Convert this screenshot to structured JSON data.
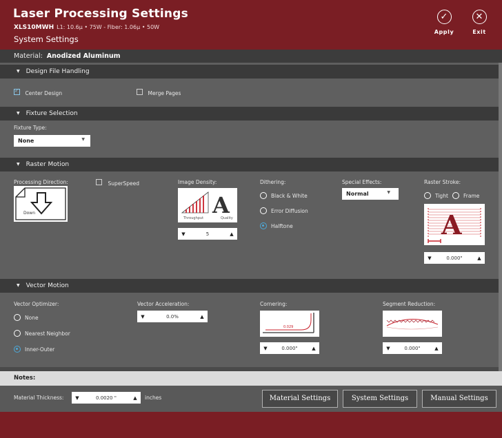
{
  "header": {
    "title": "Laser Processing Settings",
    "machine_model": "XLS10MWH",
    "machine_details": "L1: 10.6µ • 75W - Fiber: 1.06µ • 50W",
    "subtitle": "System Settings",
    "apply_label": "Apply",
    "exit_label": "Exit"
  },
  "material": {
    "label": "Material:",
    "value": "Anodized Aluminum"
  },
  "design_file": {
    "title": "Design File Handling",
    "center_design": {
      "label": "Center Design",
      "checked": true
    },
    "merge_pages": {
      "label": "Merge Pages",
      "checked": false
    }
  },
  "fixture": {
    "title": "Fixture Selection",
    "type_label": "Fixture Type:",
    "type_value": "None"
  },
  "raster": {
    "title": "Raster Motion",
    "direction_label": "Processing Direction:",
    "direction_value": "Down",
    "superspeed_label": "SuperSpeed",
    "density_label": "Image Density:",
    "density_left": "Throughput",
    "density_right": "Quality",
    "density_value": "5",
    "dithering_label": "Dithering:",
    "dithering_options": [
      "Black & White",
      "Error Diffusion",
      "Halftone"
    ],
    "dithering_selected": "Halftone",
    "effects_label": "Special Effects:",
    "effects_value": "Normal",
    "stroke_label": "Raster Stroke:",
    "stroke_tight": "Tight",
    "stroke_frame": "Frame",
    "stroke_value": "0.000\""
  },
  "vector": {
    "title": "Vector Motion",
    "optimizer_label": "Vector Optimizer:",
    "optimizer_options": [
      "None",
      "Nearest Neighbor",
      "Inner-Outer"
    ],
    "optimizer_selected": "Inner-Outer",
    "accel_label": "Vector Acceleration:",
    "accel_value": "0.0%",
    "cornering_label": "Cornering:",
    "cornering_graphic_value": "0.029",
    "cornering_value": "0.000\"",
    "segment_label": "Segment Reduction:",
    "segment_value": "0.000\""
  },
  "notes": {
    "label": "Notes:"
  },
  "footer": {
    "thickness_label": "Material Thickness:",
    "thickness_value": "0.0020 \"",
    "thickness_unit": "inches",
    "material_settings": "Material Settings",
    "system_settings": "System Settings",
    "manual_settings": "Manual Settings"
  },
  "colors": {
    "header": "#7a1e24",
    "accent": "#4da9d9",
    "body": "#5f5f5f"
  },
  "icons": [
    "check-circle-icon",
    "close-circle-icon",
    "down-arrow-icon"
  ]
}
